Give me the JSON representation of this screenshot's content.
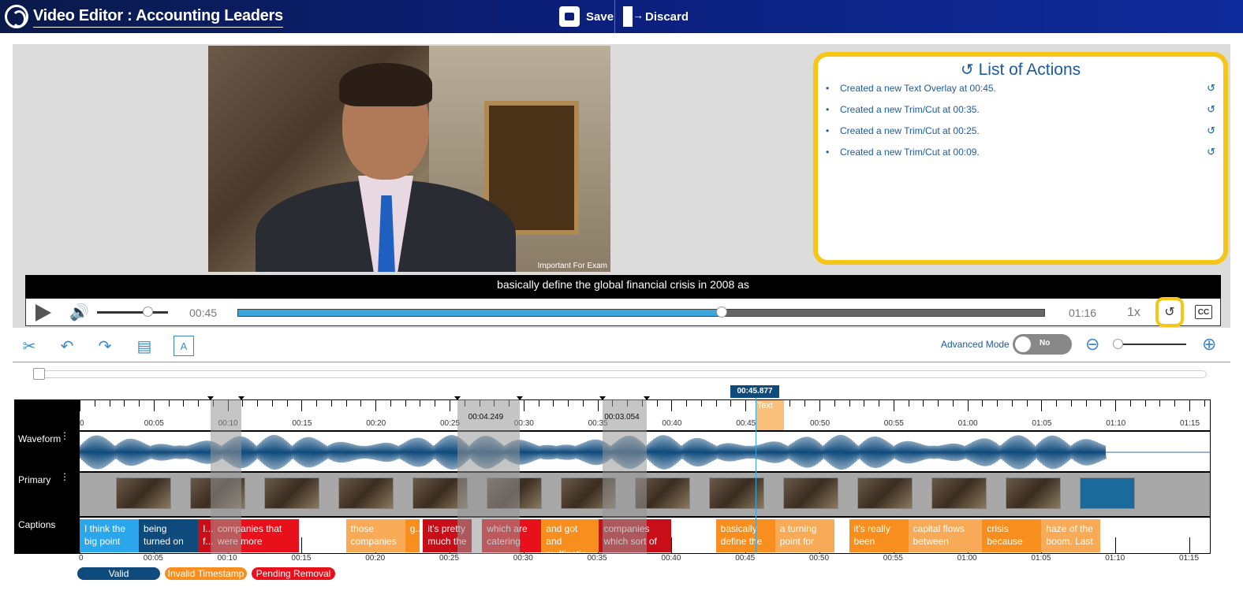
{
  "header": {
    "title": "Video Editor : Accounting Leaders",
    "save_label": "Save",
    "discard_label": "Discard"
  },
  "video": {
    "overlay_text": "Important For Exam",
    "caption_text": "basically define the global financial crisis in 2008 as"
  },
  "actions_panel": {
    "title": "List of Actions",
    "items": [
      "Created a new Text Overlay at 00:45.",
      "Created a new Trim/Cut at 00:35.",
      "Created a new Trim/Cut at 00:25.",
      "Created a new Trim/Cut at 00:09."
    ]
  },
  "player": {
    "current_time": "00:45",
    "end_time": "01:16",
    "speed": "1x",
    "cc_label": "CC",
    "volume_fraction": 0.65,
    "progress_fraction": 0.6
  },
  "toolbar": {
    "advanced_mode_label": "Advanced Mode",
    "advanced_mode_value": "No"
  },
  "timeline": {
    "playhead_label": "00:45.877",
    "tracks": {
      "waveform": "Waveform",
      "primary": "Primary",
      "captions": "Captions"
    },
    "ticks": [
      "0",
      "00:05",
      "00:10",
      "00:15",
      "00:20",
      "00:25",
      "00:30",
      "00:35",
      "00:40",
      "00:45",
      "00:50",
      "00:55",
      "01:00",
      "01:05",
      "01:10",
      "01:15"
    ],
    "cuts": [
      {
        "start_s": 8.9,
        "end_s": 11.0,
        "label": ""
      },
      {
        "start_s": 25.6,
        "end_s": 29.8,
        "label": "00:04.249"
      },
      {
        "start_s": 35.4,
        "end_s": 38.4,
        "label": "00:03.054"
      }
    ],
    "text_overlay_label": "Text",
    "captions": [
      {
        "text": "I think the big point",
        "status": "vb"
      },
      {
        "text": "being turned on",
        "status": "v"
      },
      {
        "text": "I... f...",
        "status": "rd"
      },
      {
        "text": "companies that were more",
        "status": "r"
      },
      {
        "text": "those companies",
        "status": "ol"
      },
      {
        "text": "g...",
        "status": "o"
      },
      {
        "text": "it's pretty much the",
        "status": "rd"
      },
      {
        "text": "which are catering",
        "status": "r"
      },
      {
        "text": "and got and multinatio...",
        "status": "o"
      },
      {
        "text": "companies which sort of",
        "status": "rd"
      },
      {
        "text": "basically define the",
        "status": "o"
      },
      {
        "text": "a turning point for",
        "status": "ol"
      },
      {
        "text": "it's really been",
        "status": "o"
      },
      {
        "text": "capital flows between",
        "status": "ol"
      },
      {
        "text": "crisis because",
        "status": "o"
      },
      {
        "text": "haze of the boom. Last",
        "status": "ol"
      }
    ]
  },
  "legend": {
    "valid": "Valid",
    "invalid": "Invalid Timestamp",
    "pending": "Pending Removal"
  },
  "colors": {
    "accent": "#3aa6dc",
    "valid": "#0e4a7c",
    "invalid": "#f88e1e",
    "pending": "#e8101a",
    "highlight": "#f5c518"
  }
}
